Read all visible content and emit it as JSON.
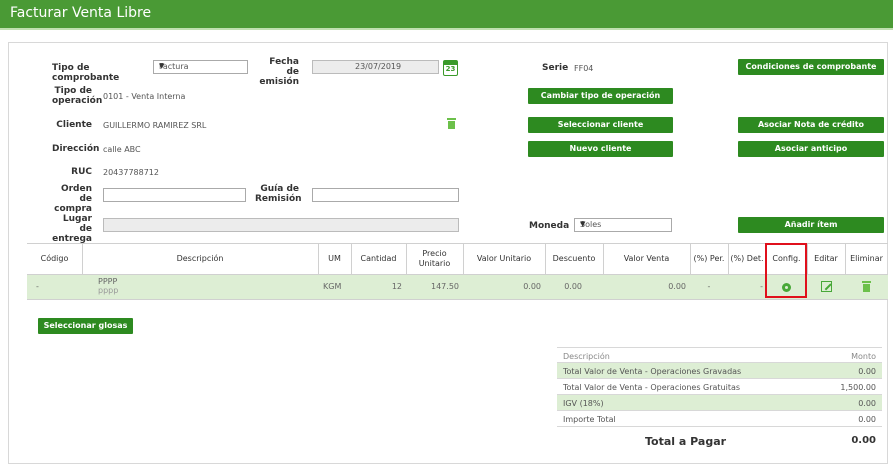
{
  "window": {
    "title": "Facturar Venta Libre"
  },
  "form": {
    "tipo_comprobante_label": "Tipo de comprobante",
    "tipo_comprobante_value": "Factura",
    "fecha_emision_label_1": "Fecha de",
    "fecha_emision_label_2": "emisión",
    "fecha_emision_value": "23/07/2019",
    "calendar_day": "23",
    "serie_label": "Serie",
    "serie_value": "FF04",
    "tipo_operacion_label_1": "Tipo de",
    "tipo_operacion_label_2": "operación",
    "tipo_operacion_value": "0101 - Venta Interna",
    "cliente_label": "Cliente",
    "cliente_value": "GUILLERMO RAMIREZ SRL",
    "direccion_label": "Dirección",
    "direccion_value": "calle ABC",
    "ruc_label": "RUC",
    "ruc_value": "20437788712",
    "orden_compra_label_1": "Orden de",
    "orden_compra_label_2": "compra",
    "guia_remision_label_1": "Guía de",
    "guia_remision_label_2": "Remisión",
    "lugar_entrega_label_1": "Lugar de",
    "lugar_entrega_label_2": "entrega",
    "moneda_label": "Moneda",
    "moneda_value": "Soles"
  },
  "buttons": {
    "condiciones": "Condiciones de comprobante",
    "cambiar_tipo": "Cambiar tipo de operación",
    "seleccionar_cliente": "Seleccionar cliente",
    "asociar_nota": "Asociar Nota de crédito",
    "nuevo_cliente": "Nuevo cliente",
    "asociar_anticipo": "Asociar anticipo",
    "anadir_item": "Añadir ítem",
    "seleccionar_glosas": "Seleccionar glosas"
  },
  "table": {
    "headers": {
      "codigo": "Código",
      "descripcion": "Descripción",
      "um": "UM",
      "cantidad": "Cantidad",
      "precio_1": "Precio",
      "precio_2": "Unitario",
      "valor_unitario": "Valor Unitario",
      "descuento": "Descuento",
      "valor_venta": "Valor Venta",
      "per": "(%) Per.",
      "det": "(%) Det.",
      "config": "Config.",
      "editar": "Editar",
      "eliminar": "Eliminar"
    },
    "rows": [
      {
        "codigo": "-",
        "descripcion_1": "PPPP",
        "descripcion_2": "pppp",
        "um": "KGM",
        "cantidad": "12",
        "precio_unitario": "147.50",
        "valor_unitario": "0.00",
        "descuento": "0.00",
        "valor_venta": "0.00",
        "per": "-",
        "det": "-"
      }
    ]
  },
  "summary": {
    "header_desc": "Descripción",
    "header_monto": "Monto",
    "rows": [
      {
        "label": "Total Valor de Venta - Operaciones Gravadas",
        "value": "0.00"
      },
      {
        "label": "Total Valor de Venta - Operaciones Gratuitas",
        "value": "1,500.00"
      },
      {
        "label": "IGV (18%)",
        "value": "0.00"
      },
      {
        "label": "Importe Total",
        "value": "0.00"
      }
    ],
    "total_label": "Total a Pagar",
    "total_value": "0.00"
  },
  "colors": {
    "brand_green": "#4a9a35",
    "button_green": "#2d8a20",
    "row_highlight": "#ddeed4",
    "highlight_box": "#e0101c"
  }
}
